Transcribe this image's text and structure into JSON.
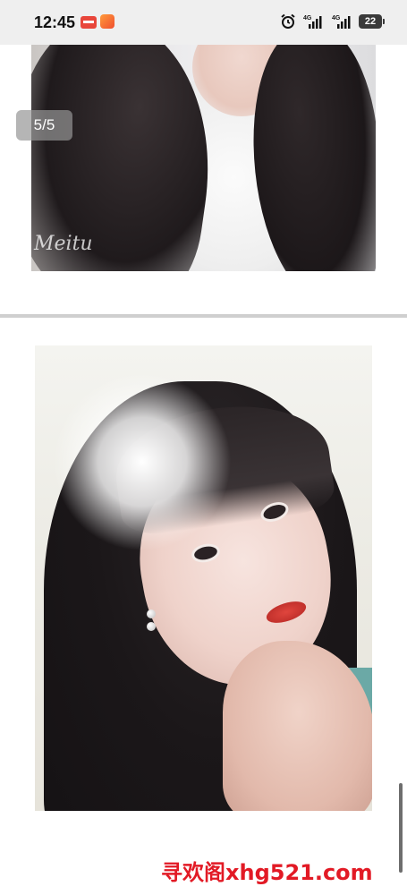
{
  "status_bar": {
    "time": "12:45",
    "notification_icons": [
      "news-app-icon",
      "shopping-app-icon"
    ],
    "indicators": [
      "alarm-icon",
      "signal-4g-icon",
      "signal-4g-icon"
    ],
    "network_1": "4G",
    "network_2": "4G",
    "battery_level": "22"
  },
  "gallery": {
    "counter": "5/5",
    "photo_1_watermark": "Meitu"
  },
  "footer": {
    "site_watermark": "寻欢阁xhg521.com"
  },
  "colors": {
    "status_bar_bg": "#efefef",
    "watermark_red": "#e21a25",
    "divider": "#cfcfcf"
  }
}
